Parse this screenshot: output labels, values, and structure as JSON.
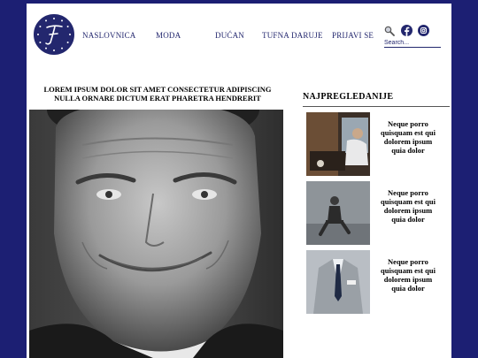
{
  "nav": {
    "items": [
      "NASLOVNICA",
      "MODA",
      "DUĆAN",
      "TUFNA DARUJE",
      "PRIJAVI SE"
    ]
  },
  "search": {
    "placeholder": "Search..."
  },
  "article": {
    "title": "LOREM IPSUM DOLOR SIT AMET CONSECTETUR ADIPISCING NULLA ORNARE DICTUM ERAT PHARETRA HENDRERIT"
  },
  "sidebar": {
    "title": "NAJPREGLEDANIJE",
    "cards": [
      {
        "text": "Neque porro quisquam est qui dolorem ipsum quia dolor"
      },
      {
        "text": "Neque porro quisquam est qui dolorem ipsum quia dolor"
      },
      {
        "text": "Neque porro quisquam est qui dolorem ipsum quia dolor"
      }
    ]
  },
  "colors": {
    "brand": "#23276e",
    "background": "#1c1f73",
    "page": "#ffffff"
  },
  "icons": [
    "logo-monogram",
    "search-icon",
    "facebook-icon",
    "instagram-icon"
  ]
}
